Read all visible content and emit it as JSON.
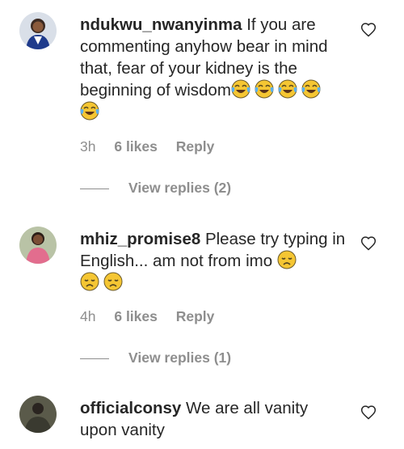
{
  "comments": [
    {
      "username": "ndukwu_nwanyinma",
      "text": "If you are commenting anyhow bear in mind that, fear of your kidney is the beginning of wisdom",
      "emojis": [
        "face-with-tears-of-joy",
        "face-with-tears-of-joy",
        "face-with-tears-of-joy",
        "face-with-tears-of-joy",
        "face-with-tears-of-joy"
      ],
      "time": "3h",
      "likes": "6 likes",
      "reply": "Reply",
      "view_replies": "View replies (2)"
    },
    {
      "username": "mhiz_promise8",
      "text": "Please try typing in English... am not from imo",
      "emojis": [
        "disappointed-face",
        "disappointed-face",
        "disappointed-face"
      ],
      "time": "4h",
      "likes": "6 likes",
      "reply": "Reply",
      "view_replies": "View replies (1)"
    },
    {
      "username": "officialconsy",
      "text": "We are all vanity upon vanity"
    }
  ],
  "colors": {
    "text": "#262626",
    "muted": "#8e8e8e",
    "background": "#ffffff"
  },
  "icons": {
    "like": "heart-outline-icon"
  }
}
